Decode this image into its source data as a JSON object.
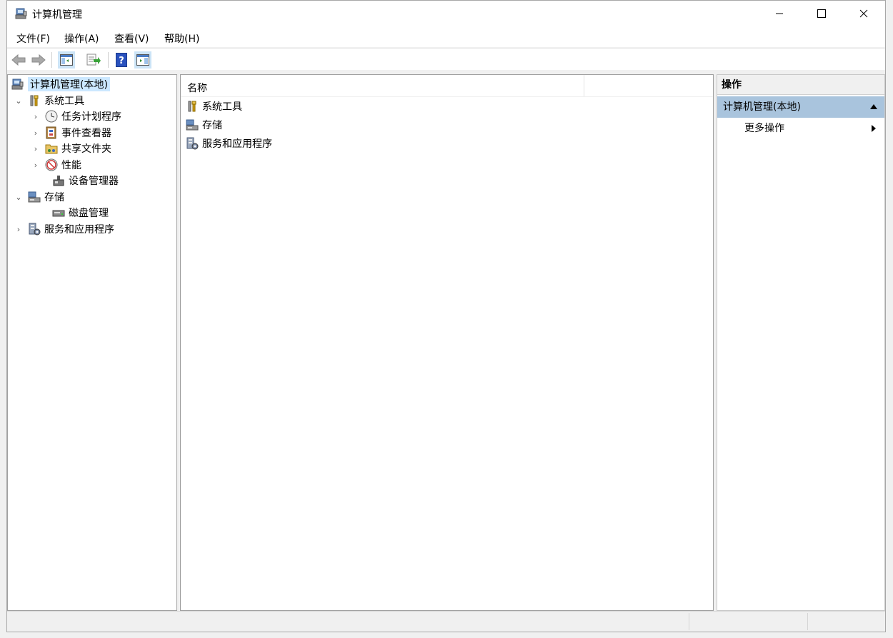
{
  "window": {
    "title": "计算机管理"
  },
  "menu": [
    "文件(F)",
    "操作(A)",
    "查看(V)",
    "帮助(H)"
  ],
  "toolbar": [
    {
      "icon": "back-arrow-icon"
    },
    {
      "icon": "forward-arrow-icon"
    },
    {
      "icon": "show-hide-console-tree-icon"
    },
    {
      "icon": "export-list-icon"
    },
    {
      "icon": "help-icon"
    },
    {
      "icon": "show-hide-action-pane-icon"
    }
  ],
  "tree": {
    "root": "计算机管理(本地)",
    "items": [
      {
        "label": "系统工具",
        "icon": "tools-icon",
        "expanded": true
      },
      {
        "label": "任务计划程序",
        "icon": "clock-icon"
      },
      {
        "label": "事件查看器",
        "icon": "event-viewer-icon"
      },
      {
        "label": "共享文件夹",
        "icon": "shared-folder-icon"
      },
      {
        "label": "性能",
        "icon": "performance-icon"
      },
      {
        "label": "设备管理器",
        "icon": "device-manager-icon"
      },
      {
        "label": "存储",
        "icon": "storage-icon",
        "expanded": true
      },
      {
        "label": "磁盘管理",
        "icon": "disk-icon"
      },
      {
        "label": "服务和应用程序",
        "icon": "services-icon"
      }
    ]
  },
  "list": {
    "column": "名称",
    "rows": [
      "系统工具",
      "存储",
      "服务和应用程序"
    ]
  },
  "actions": {
    "title": "操作",
    "section": "计算机管理(本地)",
    "item": "更多操作"
  },
  "colors": {
    "selection": "#cce8ff",
    "action_section": "#a9c4dd"
  }
}
